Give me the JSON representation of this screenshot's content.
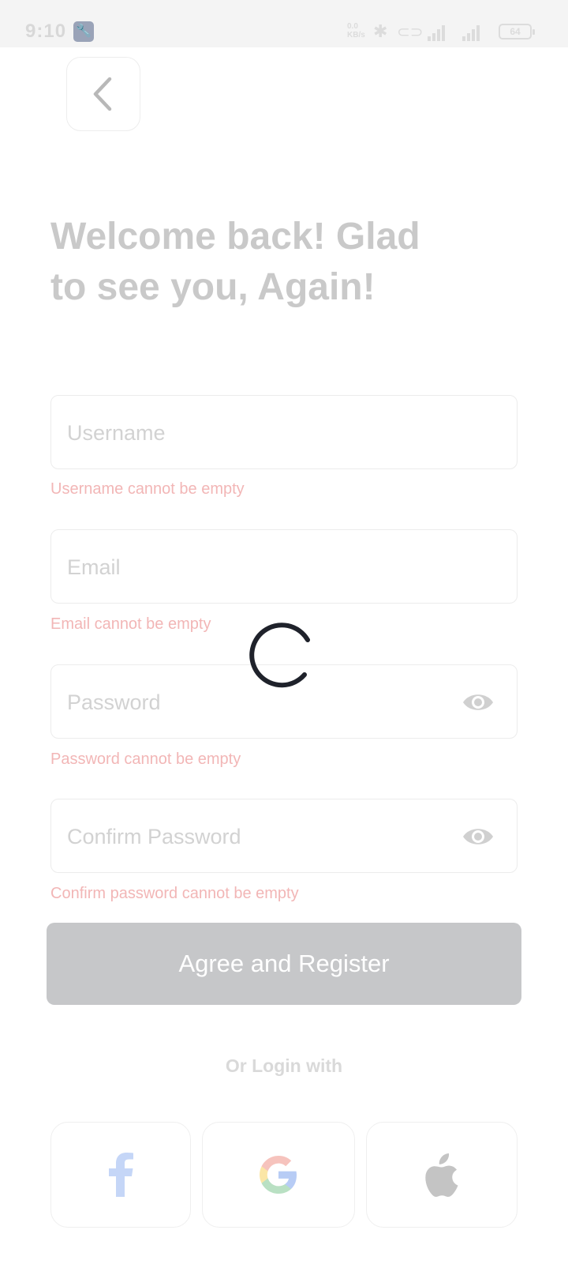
{
  "status_bar": {
    "time": "9:10",
    "network_speed": "0.0 KB/s",
    "battery": "64"
  },
  "heading": {
    "line1": "Welcome back! Glad",
    "line2": "to see you, Again!"
  },
  "form": {
    "username_placeholder": "Username",
    "username_error": "Username cannot be empty",
    "email_placeholder": "Email",
    "email_error": "Email cannot be empty",
    "password_placeholder": "Password",
    "password_error": "Password cannot be empty",
    "confirm_placeholder": "Confirm Password",
    "confirm_error": "Confirm password cannot be empty"
  },
  "register_button": "Agree and Register",
  "or_login_with": "Or Login with",
  "social_buttons": [
    {
      "provider": "Facebook",
      "icon": "facebook-icon"
    },
    {
      "provider": "Google",
      "icon": "google-icon"
    },
    {
      "provider": "Apple",
      "icon": "apple-icon"
    }
  ],
  "colors": {
    "heading": "#c9c9c9",
    "error_text": "#f2b6b6",
    "button_disabled": "#c6c7c9",
    "spinner": "#1f222b"
  }
}
